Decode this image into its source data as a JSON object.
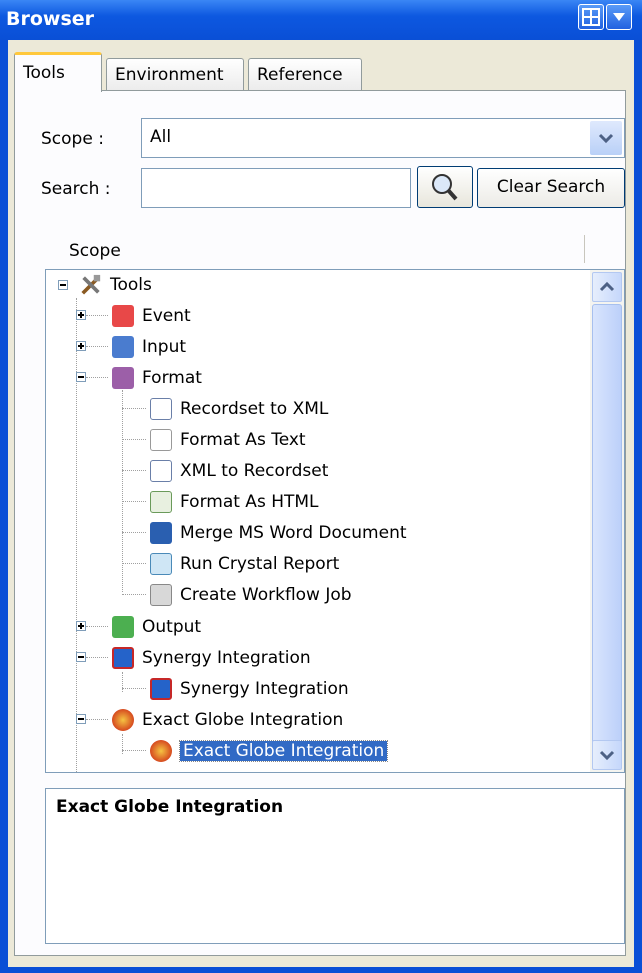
{
  "window": {
    "title": "Browser"
  },
  "tabs": [
    {
      "label": "Tools",
      "active": true
    },
    {
      "label": "Environment",
      "active": false
    },
    {
      "label": "Reference",
      "active": false
    }
  ],
  "scope": {
    "label": "Scope :",
    "value": "All"
  },
  "search": {
    "label": "Search :",
    "value": "",
    "placeholder": "",
    "clear_label": "Clear Search"
  },
  "tree_header": "Scope",
  "tree": {
    "root": "Tools",
    "nodes": [
      {
        "label": "Event",
        "color": "#e84848"
      },
      {
        "label": "Input",
        "color": "#4a7ccf"
      },
      {
        "label": "Format",
        "color": "#9c5fa8"
      },
      {
        "label": "Recordset to XML"
      },
      {
        "label": "Format As Text"
      },
      {
        "label": "XML to Recordset"
      },
      {
        "label": "Format As HTML"
      },
      {
        "label": "Merge MS Word Document"
      },
      {
        "label": "Run Crystal Report"
      },
      {
        "label": "Create Workflow Job"
      },
      {
        "label": "Output",
        "color": "#4caf50"
      },
      {
        "label": "Synergy Integration"
      },
      {
        "label": "Synergy Integration"
      },
      {
        "label": "Exact Globe Integration"
      },
      {
        "label": "Exact Globe Integration",
        "selected": true
      }
    ]
  },
  "description": {
    "title": "Exact Globe Integration"
  },
  "colors": {
    "titlebar": "#0a4fd6",
    "selection": "#316ac5"
  }
}
